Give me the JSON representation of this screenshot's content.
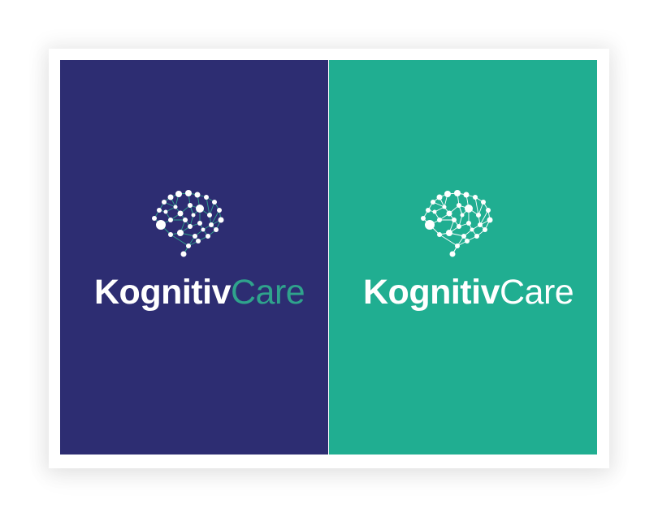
{
  "panels": [
    {
      "background": "#2d2d72",
      "brain_color": "#ffffff",
      "brain_link_color": "#2fa38c",
      "wordmark_part1": "Kognitiv",
      "wordmark_part2": "Care",
      "part1_color": "#ffffff",
      "part2_color": "#2fa38c"
    },
    {
      "background": "#20ae91",
      "brain_color": "#ffffff",
      "brain_link_color": "#ffffff",
      "wordmark_part1": "Kognitiv",
      "wordmark_part2": "Care",
      "part1_color": "#ffffff",
      "part2_color": "#ffffff"
    }
  ],
  "logo_icon": "brain-network-icon"
}
